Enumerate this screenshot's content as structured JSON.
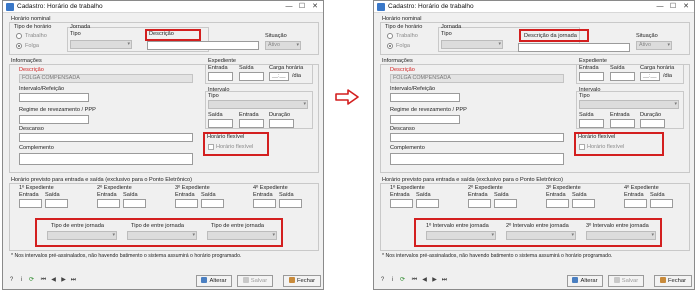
{
  "window": {
    "title": "Cadastro: Horário de trabalho",
    "controls": [
      "—",
      "☐",
      "✕"
    ]
  },
  "nominal": {
    "group_label": "Horário nominal",
    "type_label": "Tipo de horário",
    "radio_work": "Trabalho",
    "radio_off": "Folga",
    "shift_label": "Jornada",
    "shift_type_label": "Tipo",
    "description_label": "Descrição",
    "description_label_after": "Descrição da jornada",
    "status_label": "Situação",
    "status_value": "Ativo"
  },
  "info": {
    "group_label": "Informações",
    "description_label": "Descrição",
    "description_value": "FOLGA COMPENSADA",
    "interval_label": "Intervalo/Refeição",
    "regime_label": "Regime de revezamento / PPP",
    "rest_label": "Descanso",
    "complement_label": "Complemento"
  },
  "expediente": {
    "label": "Expediente",
    "entry": "Entrada",
    "exit": "Saída",
    "workload": "Carga horária",
    "workload_placeholder": "__:__",
    "per_day": "/dia"
  },
  "interval": {
    "label": "Intervalo",
    "type_label": "Tipo",
    "exit": "Saída",
    "entry": "Entrada",
    "duration": "Duração"
  },
  "flexible": {
    "title": "Horário flexível",
    "checkbox": "Horário flexível"
  },
  "planned": {
    "group_label": "Horário previsto para entrada e saída  (exclusivo para o Ponto Eletrônico)",
    "entry": "Entrada",
    "exit": "Saída",
    "shifts": [
      "1º Expediente",
      "2º Expediente",
      "3º Expediente",
      "4º Expediente"
    ],
    "between_before": [
      "Tipo de entre jornada",
      "Tipo de entre jornada",
      "Tipo de entre jornada"
    ],
    "between_after": [
      "1º Intervalo entre jornada",
      "2º Intervalo entre jornada",
      "3º Intervalo entre jornada"
    ]
  },
  "footer": {
    "note": "* Nos intervalos pré-assinalados, não havendo batimento o sistema assumirá o horário programado.",
    "change": "Alterar",
    "save": "Salvar",
    "close": "Fechar",
    "nav_icons": [
      "help-icon",
      "info-icon",
      "refresh-icon",
      "first-icon",
      "prev-icon",
      "next-icon",
      "last-icon"
    ],
    "nav_glyphs": [
      "?",
      "i",
      "⟳",
      "⏮",
      "◀",
      "▶",
      "⏭"
    ]
  },
  "colors": {
    "highlight": "#d31f1f",
    "arrow": "#d31f1f"
  }
}
